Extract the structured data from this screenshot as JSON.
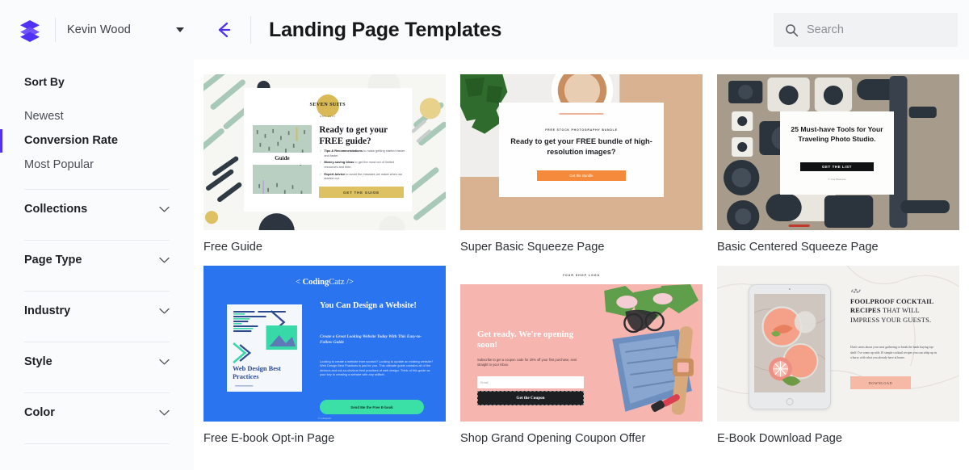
{
  "header": {
    "logo_icon": "stacked-layers-logo",
    "account_name": "Kevin Wood",
    "account_caret_icon": "caret-down-icon",
    "back_icon": "arrow-left-icon",
    "page_title": "Landing Page Templates",
    "search": {
      "icon": "search-icon",
      "placeholder": "Search",
      "value": ""
    }
  },
  "colors": {
    "accent_purple": "#4f33f5",
    "header_bg": "#fafbfc",
    "sidebar_bg": "#fafbfc",
    "search_bg": "#f1f2f3",
    "divider": "#e7e9ec",
    "text_primary": "#1d2024",
    "text_secondary": "#4a4f56"
  },
  "sidebar": {
    "sort_heading": "Sort By",
    "sort_options": [
      {
        "label": "Newest",
        "active": false
      },
      {
        "label": "Conversion Rate",
        "active": true
      },
      {
        "label": "Most Popular",
        "active": false
      }
    ],
    "filters": [
      {
        "label": "Collections",
        "icon": "chevron-down-icon",
        "expanded": false
      },
      {
        "label": "Page Type",
        "icon": "chevron-down-icon",
        "expanded": false
      },
      {
        "label": "Industry",
        "icon": "chevron-down-icon",
        "expanded": false
      },
      {
        "label": "Style",
        "icon": "chevron-down-icon",
        "expanded": false
      },
      {
        "label": "Color",
        "icon": "chevron-down-icon",
        "expanded": false
      }
    ]
  },
  "templates": [
    {
      "title": "Free Guide",
      "preview": {
        "logo_name": "SEVEN SUITS",
        "logo_sub": "EST. 2016",
        "book_label": "Guide",
        "headline": "Ready to get your FREE guide?",
        "bullets": [
          {
            "lead": "Tips & Recommendations",
            "rest": " to make getting started easier and faster."
          },
          {
            "lead": "Money-saving Ideas",
            "rest": " to get the most out of limited resources and time."
          },
          {
            "lead": "Expert Advice",
            "rest": " to avoid the mistakes we made when we started out."
          }
        ],
        "cta": "GET THE GUIDE"
      }
    },
    {
      "title": "Super Basic Squeeze Page",
      "preview": {
        "eyebrow": "FREE STOCK PHOTOGRAPHY BUNDLE",
        "headline": "Ready to get your FREE bundle of high-resolution images?",
        "cta": "Get the Bundle"
      }
    },
    {
      "title": "Basic Centered Squeeze Page",
      "preview": {
        "headline": "25 Must-have Tools for Your Traveling Photo Studio.",
        "cta": "GET THE LIST",
        "footer": "© Your Business"
      }
    },
    {
      "title": "Free E-book Opt-in Page",
      "preview": {
        "brand_pre": "< ",
        "brand_bold": "Coding",
        "brand_light": "Catz",
        "brand_post": " />",
        "book_title": "Web Design Best Practices",
        "headline": "You Can Design a Website!",
        "subhead": "Create a Great Looking Website Today With This Easy-to-Follow Guide",
        "paragraph": "Looking to create a website from scratch? Looking to update an existing website? Web Design Best Practices is just for you. This ultimate guide contains all of the obvious and not-so-obvious best practices of web design. Think of this guide as your key to creating a website with any skillset.",
        "cta": "Send Me the Free E-book",
        "footer": "© CodingCatz"
      }
    },
    {
      "title": "Shop Grand Opening Coupon Offer",
      "preview": {
        "shop_logo": "YOUR SHOP LOGO",
        "headline": "Get ready. We're opening soon!",
        "paragraph": "Subscribe to get a coupon code for 20% off your first purchase, sent straight to your inbox.",
        "email_placeholder": "Email",
        "cta": "Get the Coupon"
      }
    },
    {
      "title": "E-Book Download Page",
      "preview": {
        "headline_bold": "FOOLPROOF COCKTAIL RECIPES",
        "headline_rest": " THAT WILL IMPRESS YOUR GUESTS.",
        "paragraph": "Don't stress about your next gathering or break the bank buying top-shelf. I've come up with 10 simple cocktail recipes you can whip up in a hurry with what you already have at home.",
        "cta": "DOWNLOAD"
      }
    }
  ]
}
